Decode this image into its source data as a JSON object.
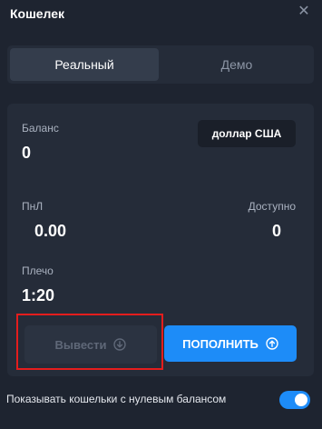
{
  "header": {
    "title": "Кошелек",
    "close_icon": "close-icon"
  },
  "tabs": [
    {
      "label": "Реальный",
      "active": true
    },
    {
      "label": "Демо",
      "active": false
    }
  ],
  "account": {
    "balance_label": "Баланс",
    "balance_value": "0",
    "currency": "доллар США",
    "pnl_label": "ПнЛ",
    "pnl_value": "0.00",
    "available_label": "Доступно",
    "available_value": "0",
    "leverage_label": "Плечо",
    "leverage_value": "1:20"
  },
  "actions": {
    "withdraw_label": "Вывести",
    "withdraw_icon": "arrow-down-circle-icon",
    "deposit_label": "ПОПОЛНИТЬ",
    "deposit_icon": "arrow-up-circle-icon"
  },
  "footer": {
    "show_zero_label": "Показывать кошельки с нулевым балансом",
    "show_zero_enabled": true
  },
  "colors": {
    "background": "#1e2430",
    "card": "#252c39",
    "accent": "#1d8cf8",
    "highlight": "#e41d1d"
  }
}
